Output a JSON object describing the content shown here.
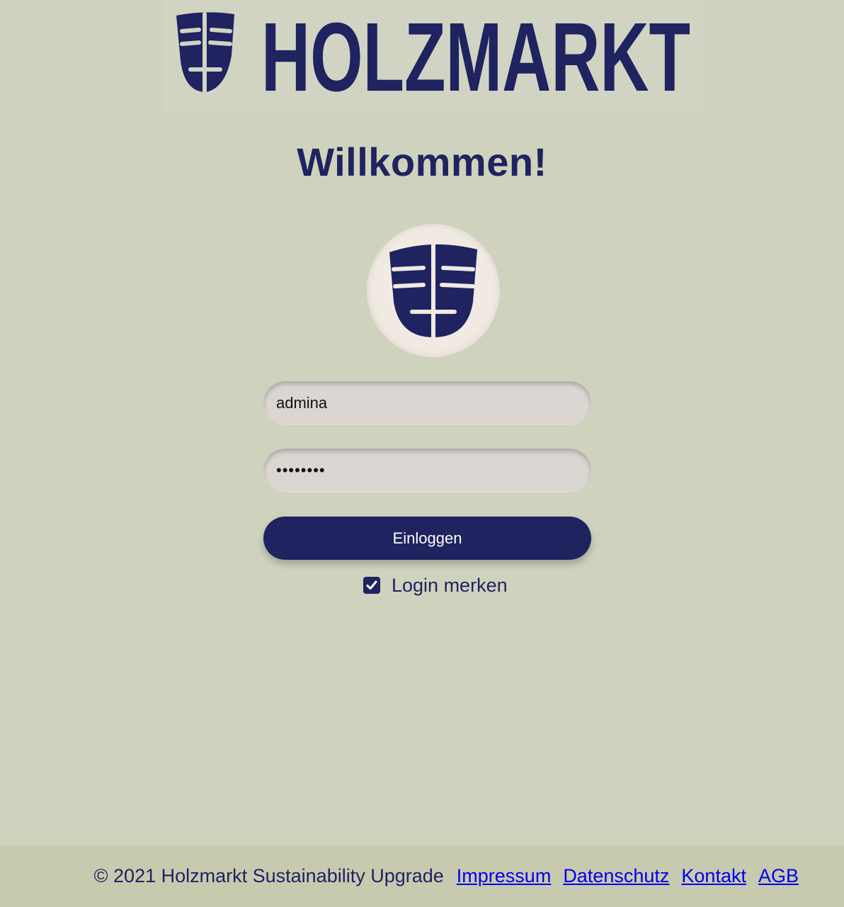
{
  "brand": {
    "logo_text": "HOLZMARKT",
    "color": "#1f2360"
  },
  "welcome": {
    "title": "Willkommen!"
  },
  "avatar": {
    "icon": "holzmarkt-mask-icon"
  },
  "login_form": {
    "username_value": "admina",
    "password_value": "••••••••",
    "submit_label": "Einloggen",
    "remember_label": "Login merken",
    "remember_checked": true
  },
  "footer": {
    "copyright": "© 2021 Holzmarkt Sustainability Upgrade",
    "links": [
      "Impressum",
      "Datenschutz",
      "Kontakt",
      "AGB"
    ]
  },
  "colors": {
    "background": "#cfd2bd",
    "accent": "#1f2360",
    "link": "#0000ee"
  }
}
